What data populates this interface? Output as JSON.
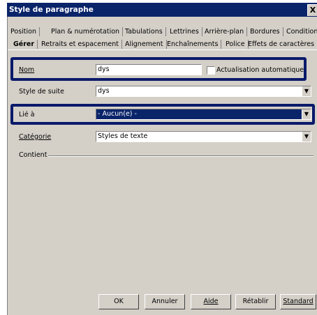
{
  "window": {
    "title": "Style de paragraphe",
    "close_glyph": "X"
  },
  "tabs_row1": [
    "Position",
    "Plan & numérotation",
    "Tabulations",
    "Lettrines",
    "Arrière-plan",
    "Bordures",
    "Condition"
  ],
  "tabs_row2": [
    "Gérer",
    "Retraits et espacement",
    "Alignement",
    "Enchaînements",
    "Police",
    "Effets de caractères"
  ],
  "active_tab": "Gérer",
  "form": {
    "nom_label": "Nom",
    "nom_value": "dys",
    "auto_update_label": "Actualisation automatique",
    "auto_update_checked": false,
    "style_suite_label": "Style de suite",
    "style_suite_value": "dys",
    "lie_label": "Lié à",
    "lie_value": "- Aucun(e) -",
    "categorie_label": "Catégorie",
    "categorie_value": "Styles de texte",
    "contient_label": "Contient"
  },
  "buttons": {
    "ok": "OK",
    "annuler": "Annuler",
    "aide": "Aide",
    "retablir": "Rétablir",
    "standard": "Standard"
  },
  "colors": {
    "titlebar": "#0a246a",
    "highlight_border": "#0a1a6a",
    "dialog_bg": "#d4d0c8"
  }
}
